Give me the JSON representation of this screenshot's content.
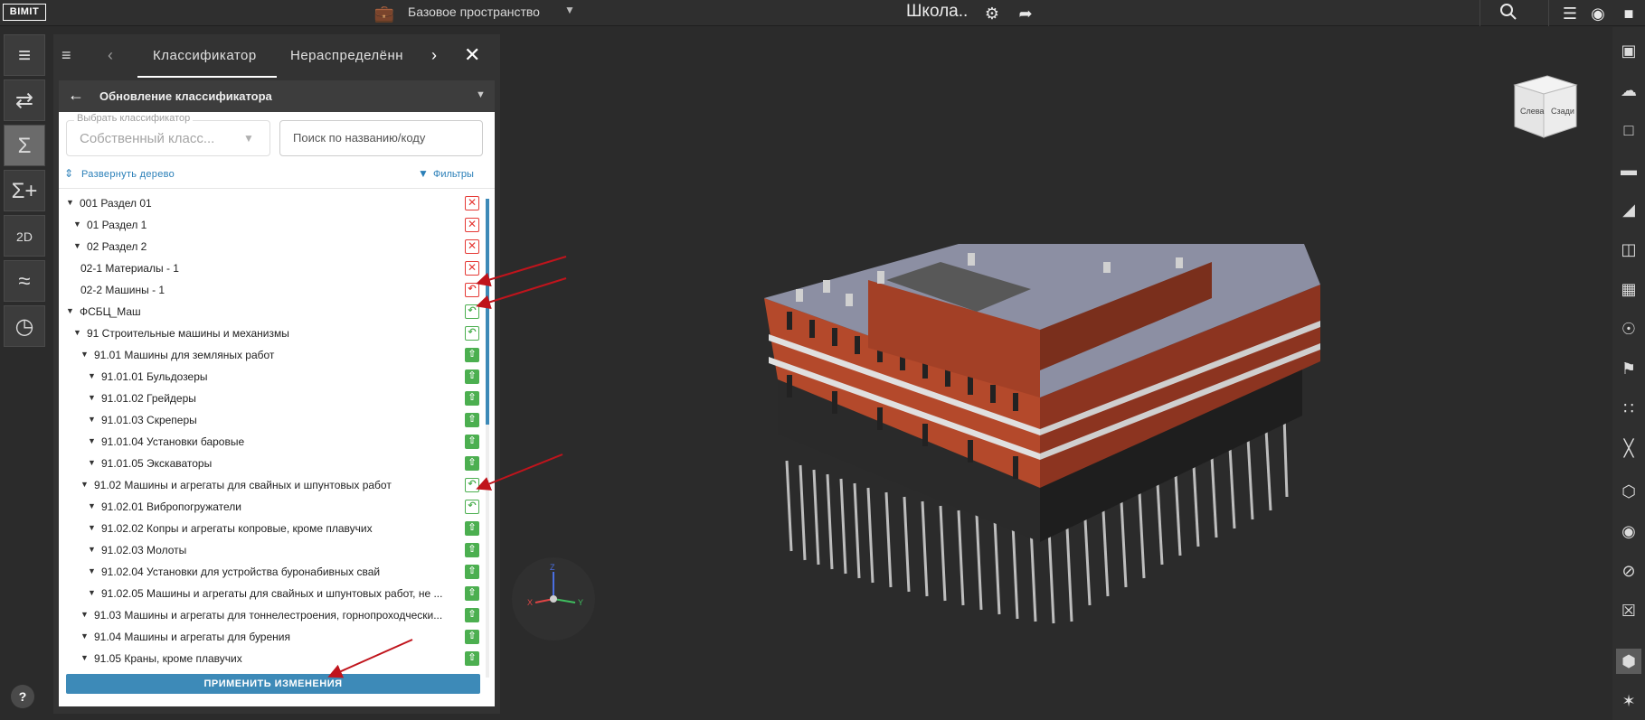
{
  "topbar": {
    "logo": "BIMIT",
    "workspace": "Базовое пространство",
    "project_title": "Школа.."
  },
  "panel": {
    "tabs": [
      "Классификатор",
      "Нераспределённ"
    ],
    "subheader_title": "Обновление классификатора",
    "select_legend": "Выбрать классификатор",
    "select_value": "Собственный класс...",
    "search_placeholder": "Поиск по названию/коду",
    "expand_label": "Развернуть дерево",
    "filter_label": "Фильтры",
    "apply_label": "ПРИМЕНИТЬ ИЗМЕНЕНИЯ"
  },
  "tree": [
    {
      "label": "001 Раздел 01",
      "action": "delete",
      "toggle": true
    },
    {
      "label": "01 Раздел 1",
      "action": "delete",
      "toggle": true
    },
    {
      "label": "02 Раздел 2",
      "action": "delete",
      "toggle": true
    },
    {
      "label": "02-1 Материалы - 1",
      "action": "delete",
      "toggle": false
    },
    {
      "label": "02-2 Машины - 1",
      "action": "undo-red",
      "toggle": false
    },
    {
      "label": "ФСБЦ_Маш",
      "action": "undo",
      "toggle": true
    },
    {
      "label": "91 Строительные машины и механизмы",
      "action": "undo",
      "toggle": true
    },
    {
      "label": "91.01 Машины для земляных работ",
      "action": "add",
      "toggle": true
    },
    {
      "label": "91.01.01 Бульдозеры",
      "action": "add",
      "toggle": true
    },
    {
      "label": "91.01.02 Грейдеры",
      "action": "add",
      "toggle": true
    },
    {
      "label": "91.01.03 Скреперы",
      "action": "add",
      "toggle": true
    },
    {
      "label": "91.01.04 Установки баровые",
      "action": "add",
      "toggle": true
    },
    {
      "label": "91.01.05 Экскаваторы",
      "action": "add",
      "toggle": true
    },
    {
      "label": "91.02 Машины и агрегаты для свайных и шпунтовых работ",
      "action": "undo",
      "toggle": true
    },
    {
      "label": "91.02.01 Вибропогружатели",
      "action": "undo",
      "toggle": true
    },
    {
      "label": "91.02.02 Копры и агрегаты копровые, кроме плавучих",
      "action": "add",
      "toggle": true
    },
    {
      "label": "91.02.03 Молоты",
      "action": "add",
      "toggle": true
    },
    {
      "label": "91.02.04 Установки для устройства буронабивных свай",
      "action": "add",
      "toggle": true
    },
    {
      "label": "91.02.05 Машины и агрегаты для свайных и шпунтовых работ, не ...",
      "action": "add",
      "toggle": true
    },
    {
      "label": "91.03 Машины и агрегаты для тоннелестроения, горнопроходчески...",
      "action": "add",
      "toggle": true
    },
    {
      "label": "91.04 Машины и агрегаты для бурения",
      "action": "add",
      "toggle": true
    },
    {
      "label": "91.05 Краны, кроме плавучих",
      "action": "add",
      "toggle": true
    }
  ],
  "viewcube": {
    "faces": [
      "Слева",
      "Сзади"
    ]
  },
  "axes": {
    "x": "X",
    "y": "Y",
    "z": "Z"
  },
  "help": "?"
}
